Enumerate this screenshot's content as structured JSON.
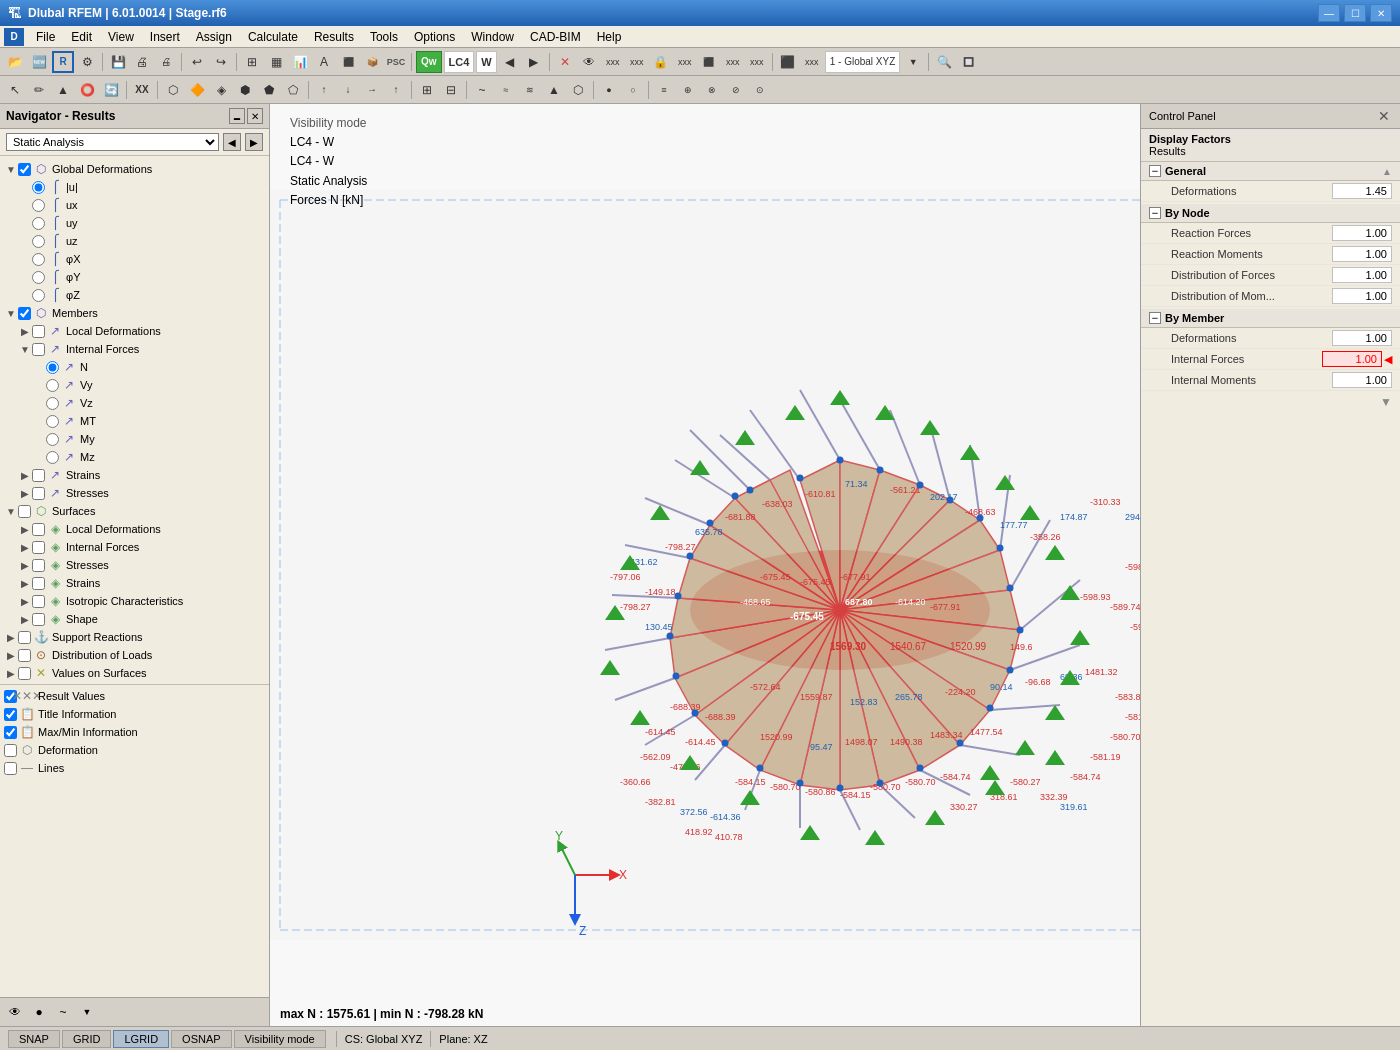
{
  "window": {
    "title": "Dlubal RFEM | 6.01.0014 | Stage.rf6",
    "icon": "🏗"
  },
  "menu": {
    "items": [
      "File",
      "Edit",
      "View",
      "Insert",
      "Assign",
      "Calculate",
      "Results",
      "Tools",
      "Options",
      "Window",
      "CAD-BIM",
      "Help"
    ]
  },
  "toolbar1": {
    "buttons": [
      "📂",
      "💾",
      "🖨",
      "↩",
      "↪",
      "📋",
      "📄",
      "🔲",
      "⊞",
      "📊",
      "🔤",
      "🔵",
      "Qw",
      "LC4",
      "W",
      "◀",
      "▶",
      "✕",
      "👁",
      "xxx",
      "xxx",
      "🔒",
      "xxx",
      "xxx",
      "🔲",
      "xxx"
    ],
    "lc_label": "LC4",
    "lc_combo": "W"
  },
  "toolbar2": {
    "buttons": [
      "↖",
      "✏",
      "▲",
      "⭕",
      "🔄",
      "XX",
      "🔀",
      "⬡",
      "🔶",
      "🔷",
      "◈",
      "⬢",
      "⬟",
      "⬠",
      "⬡"
    ]
  },
  "navigator": {
    "title": "Navigator - Results",
    "filter": "Static Analysis",
    "tree": [
      {
        "id": "global-deformations",
        "level": 0,
        "expand": true,
        "check": true,
        "icon": "deform",
        "label": "Global Deformations",
        "type": "group"
      },
      {
        "id": "deform-absU",
        "level": 1,
        "expand": false,
        "radio": true,
        "checked": true,
        "icon": "member",
        "label": "|u|",
        "type": "radio"
      },
      {
        "id": "deform-ux",
        "level": 1,
        "radio": true,
        "checked": false,
        "icon": "member",
        "label": "ux",
        "type": "radio"
      },
      {
        "id": "deform-uy",
        "level": 1,
        "radio": true,
        "checked": false,
        "icon": "member",
        "label": "uy",
        "type": "radio"
      },
      {
        "id": "deform-uz",
        "level": 1,
        "radio": true,
        "checked": false,
        "icon": "member",
        "label": "uz",
        "type": "radio"
      },
      {
        "id": "deform-phix",
        "level": 1,
        "radio": true,
        "checked": false,
        "icon": "member",
        "label": "φX",
        "type": "radio"
      },
      {
        "id": "deform-phiy",
        "level": 1,
        "radio": true,
        "checked": false,
        "icon": "member",
        "label": "φY",
        "type": "radio"
      },
      {
        "id": "deform-phiz",
        "level": 1,
        "radio": true,
        "checked": false,
        "icon": "member",
        "label": "φZ",
        "type": "radio"
      },
      {
        "id": "members",
        "level": 0,
        "expand": true,
        "check": true,
        "icon": "members-group",
        "label": "Members",
        "type": "group"
      },
      {
        "id": "local-deformations",
        "level": 1,
        "expand": false,
        "check": false,
        "icon": "local-deform",
        "label": "Local Deformations",
        "type": "subgroup"
      },
      {
        "id": "internal-forces",
        "level": 1,
        "expand": true,
        "check": false,
        "icon": "internal-forces",
        "label": "Internal Forces",
        "type": "subgroup"
      },
      {
        "id": "force-N",
        "level": 2,
        "radio": true,
        "checked": true,
        "icon": "force",
        "label": "N",
        "type": "radio"
      },
      {
        "id": "force-Vy",
        "level": 2,
        "radio": true,
        "checked": false,
        "icon": "force",
        "label": "Vy",
        "type": "radio"
      },
      {
        "id": "force-Vz",
        "level": 2,
        "radio": true,
        "checked": false,
        "icon": "force",
        "label": "Vz",
        "type": "radio"
      },
      {
        "id": "force-MT",
        "level": 2,
        "radio": true,
        "checked": false,
        "icon": "force",
        "label": "MT",
        "type": "radio"
      },
      {
        "id": "force-My",
        "level": 2,
        "radio": true,
        "checked": false,
        "icon": "force",
        "label": "My",
        "type": "radio"
      },
      {
        "id": "force-Mz",
        "level": 2,
        "radio": true,
        "checked": false,
        "icon": "force",
        "label": "Mz",
        "type": "radio"
      },
      {
        "id": "strains",
        "level": 1,
        "expand": false,
        "check": false,
        "icon": "strains",
        "label": "Strains",
        "type": "subgroup"
      },
      {
        "id": "stresses",
        "level": 1,
        "expand": false,
        "check": false,
        "icon": "stresses",
        "label": "Stresses",
        "type": "subgroup"
      },
      {
        "id": "surfaces",
        "level": 0,
        "expand": true,
        "check": false,
        "icon": "surfaces-group",
        "label": "Surfaces",
        "type": "group"
      },
      {
        "id": "surf-local-deform",
        "level": 1,
        "expand": false,
        "check": false,
        "icon": "surf-deform",
        "label": "Local Deformations",
        "type": "subgroup"
      },
      {
        "id": "surf-internal-forces",
        "level": 1,
        "expand": false,
        "check": false,
        "icon": "surf-forces",
        "label": "Internal Forces",
        "type": "subgroup"
      },
      {
        "id": "surf-stresses",
        "level": 1,
        "expand": false,
        "check": false,
        "icon": "surf-stress",
        "label": "Stresses",
        "type": "subgroup"
      },
      {
        "id": "surf-strains",
        "level": 1,
        "expand": false,
        "check": false,
        "icon": "surf-strain",
        "label": "Strains",
        "type": "subgroup"
      },
      {
        "id": "surf-isotropic",
        "level": 1,
        "expand": false,
        "check": false,
        "icon": "surf-iso",
        "label": "Isotropic Characteristics",
        "type": "subgroup"
      },
      {
        "id": "surf-shape",
        "level": 1,
        "expand": false,
        "check": false,
        "icon": "surf-shape",
        "label": "Shape",
        "type": "subgroup"
      },
      {
        "id": "support-reactions",
        "level": 0,
        "expand": false,
        "check": false,
        "icon": "support",
        "label": "Support Reactions",
        "type": "group"
      },
      {
        "id": "dist-loads",
        "level": 0,
        "expand": false,
        "check": false,
        "icon": "dist-loads",
        "label": "Distribution of Loads",
        "type": "group"
      },
      {
        "id": "values-surfaces",
        "level": 0,
        "expand": false,
        "check": false,
        "icon": "values",
        "label": "Values on Surfaces",
        "type": "group"
      },
      {
        "id": "divider1",
        "type": "divider"
      },
      {
        "id": "result-values",
        "level": 0,
        "expand": false,
        "check": true,
        "icon": "results",
        "label": "Result Values",
        "type": "check-item"
      },
      {
        "id": "title-info",
        "level": 0,
        "expand": false,
        "check": true,
        "icon": "title",
        "label": "Title Information",
        "type": "check-item"
      },
      {
        "id": "maxmin-info",
        "level": 0,
        "expand": false,
        "check": true,
        "icon": "maxmin",
        "label": "Max/Min Information",
        "type": "check-item"
      },
      {
        "id": "deformation-item",
        "level": 0,
        "expand": false,
        "check": false,
        "icon": "deform2",
        "label": "Deformation",
        "type": "check-item"
      },
      {
        "id": "lines",
        "level": 0,
        "expand": false,
        "check": false,
        "icon": "lines",
        "label": "Lines",
        "type": "check-item"
      }
    ]
  },
  "viewport": {
    "info_lines": [
      "Visibility mode",
      "LC4 - W",
      "LC4 - W",
      "Static Analysis",
      "Forces N [kN]"
    ],
    "status": "max N : 1575.61 | min N : -798.28 kN",
    "colors": {
      "bg": "#f8f8f8",
      "structure_fill": "#c8a080",
      "red_force": "#e03030",
      "blue_label": "#2060c0",
      "red_label": "#d03030",
      "axis_x": "#e03030",
      "axis_y": "#30a030",
      "axis_z": "#2060e0"
    }
  },
  "control_panel": {
    "title": "Control Panel",
    "subtitle": "Display Factors",
    "subtitle2": "Results",
    "sections": [
      {
        "id": "general",
        "label": "General",
        "expanded": true,
        "rows": [
          {
            "label": "Deformations",
            "value": "1.45"
          }
        ]
      },
      {
        "id": "by-node",
        "label": "By Node",
        "expanded": true,
        "rows": [
          {
            "label": "Reaction Forces",
            "value": "1.00"
          },
          {
            "label": "Reaction Moments",
            "value": "1.00"
          },
          {
            "label": "Distribution of Forces",
            "value": "1.00"
          },
          {
            "label": "Distribution of Mom...",
            "value": "1.00"
          }
        ]
      },
      {
        "id": "by-member",
        "label": "By Member",
        "expanded": true,
        "rows": [
          {
            "label": "Deformations",
            "value": "1.00"
          },
          {
            "label": "Internal Forces",
            "value": "1.00",
            "highlighted": true
          },
          {
            "label": "Internal Moments",
            "value": "1.00"
          }
        ]
      }
    ],
    "scroll_arrow": "▼"
  },
  "status_bar": {
    "buttons": [
      "SNAP",
      "GRID",
      "LGRID",
      "OSNAP",
      "Visibility mode"
    ],
    "cs": "CS: Global XYZ",
    "plane": "Plane: XZ"
  },
  "nav_footer_buttons": [
    "👁",
    "●",
    "~"
  ]
}
